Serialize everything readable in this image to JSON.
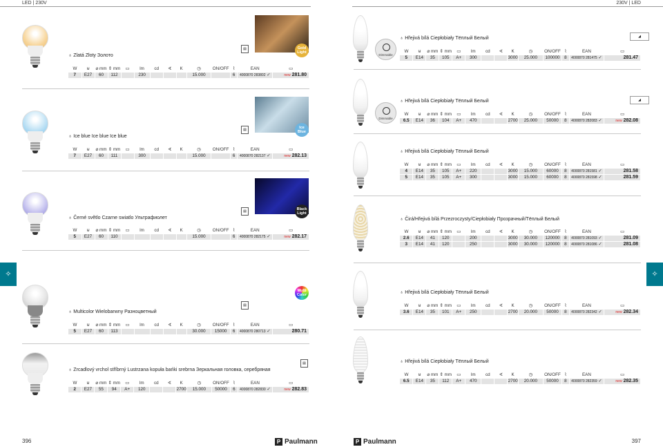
{
  "header": {
    "left": "LED | 230V",
    "right": "230V | LED"
  },
  "headers": {
    "w": "W",
    "socket": "⊌",
    "dia": "⌀ mm",
    "len": "⇕ mm",
    "shape": "▭",
    "lm": "lm",
    "cd": "cd",
    "beam": "∢",
    "k": "K",
    "life": "◷",
    "switch": "ON/OFF",
    "life2": "⌇",
    "ean": "EAN",
    "price": "▭"
  },
  "left_products": [
    {
      "name": "Zlatá  Złoty  Золото",
      "chip": "Gold Light",
      "rows": [
        {
          "w": "7",
          "socket": "E27",
          "dia": "60",
          "len": "112",
          "cls": "",
          "lm": "230",
          "cd": "",
          "beam": "",
          "k": "",
          "life": "15.000",
          "sw": "",
          "pack": "6",
          "ean": "4000870 283802",
          "new": "new",
          "price": "281.80"
        }
      ]
    },
    {
      "name": "Ice blue  Ice blue  Ice blue",
      "chip": "Ice Blue",
      "rows": [
        {
          "w": "7",
          "socket": "E27",
          "dia": "60",
          "len": "111",
          "cls": "",
          "lm": "300",
          "cd": "",
          "beam": "",
          "k": "",
          "life": "15.000",
          "sw": "",
          "pack": "6",
          "ean": "4000870 282137",
          "new": "new",
          "price": "282.13"
        }
      ]
    },
    {
      "name": "Černé světlo  Czarne swiatlo  Ультрафиолет",
      "chip": "Black Light",
      "rows": [
        {
          "w": "5",
          "socket": "E27",
          "dia": "60",
          "len": "110",
          "cls": "",
          "lm": "",
          "cd": "",
          "beam": "",
          "k": "",
          "life": "15.000",
          "sw": "",
          "pack": "6",
          "ean": "4000870 282175",
          "new": "new",
          "price": "282.17"
        }
      ]
    },
    {
      "name": "Multicolor  Wielobarwny  Разноцветный",
      "chip": "Multi Color",
      "rows": [
        {
          "w": "5",
          "socket": "E27",
          "dia": "60",
          "len": "113",
          "cls": "",
          "lm": "",
          "cd": "",
          "beam": "",
          "k": "",
          "life": "30.000",
          "sw": "15000",
          "pack": "6",
          "ean": "4000870 280713",
          "new": "",
          "price": "280.71"
        }
      ]
    },
    {
      "name": "Zrcadlový vrchol stříbrný  Lustrzana kopuła bańki srebrna  Зеркальная головка, серебряная",
      "chip": "",
      "rows": [
        {
          "w": "2",
          "socket": "E27",
          "dia": "55",
          "len": "94",
          "cls": "A+",
          "lm": "120",
          "cd": "",
          "beam": "",
          "k": "2700",
          "life": "15.000",
          "sw": "50000",
          "pack": "6",
          "ean": "4000870 282830",
          "new": "new",
          "price": "282.83"
        }
      ]
    }
  ],
  "right_products": [
    {
      "name": "Hřejivá bílá  Ciepłobiały  Тёплый Белый",
      "dimmable": "Dimmable",
      "rows": [
        {
          "w": "5",
          "socket": "E14",
          "dia": "35",
          "len": "105",
          "cls": "A+",
          "lm": "300",
          "cd": "",
          "beam": "",
          "k": "3000",
          "life": "25.000",
          "sw": "100000",
          "pack": "8",
          "ean": "4000870 281475",
          "new": "",
          "price": "281.47"
        }
      ]
    },
    {
      "name": "Hřejivá bílá  Ciepłobiały  Тёплый Белый",
      "dimmable": "Dimmable",
      "rows": [
        {
          "w": "6.5",
          "socket": "E14",
          "dia": "36",
          "len": "104",
          "cls": "A+",
          "lm": "470",
          "cd": "",
          "beam": "",
          "k": "2700",
          "life": "25.000",
          "sw": "50000",
          "pack": "8",
          "ean": "4000870 282083",
          "new": "new",
          "price": "282.08"
        }
      ]
    },
    {
      "name": "Hřejivá bílá  Ciepłobiały  Тёплый Белый",
      "dimmable": "",
      "rows": [
        {
          "w": "4",
          "socket": "E14",
          "dia": "35",
          "len": "105",
          "cls": "A+",
          "lm": "220",
          "cd": "",
          "beam": "",
          "k": "3000",
          "life": "15.000",
          "sw": "60000",
          "pack": "8",
          "ean": "4000870 281581",
          "new": "",
          "price": "281.58"
        },
        {
          "w": "5",
          "socket": "E14",
          "dia": "35",
          "len": "105",
          "cls": "A+",
          "lm": "300",
          "cd": "",
          "beam": "",
          "k": "3000",
          "life": "15.000",
          "sw": "60000",
          "pack": "8",
          "ean": "4000870 281598",
          "new": "",
          "price": "281.59"
        }
      ]
    },
    {
      "name": "Čirá/Hřejivá bílá  Przezroczysty/Ciepłobiały  Прозрачный/Тёплый Белый",
      "dimmable": "",
      "rows": [
        {
          "w": "2.6",
          "socket": "E14",
          "dia": "41",
          "len": "120",
          "cls": "",
          "lm": "200",
          "cd": "",
          "beam": "",
          "k": "3000",
          "life": "30.000",
          "sw": "120000",
          "pack": "8",
          "ean": "4000870 281093",
          "new": "",
          "price": "281.09"
        },
        {
          "w": "3",
          "socket": "E14",
          "dia": "41",
          "len": "120",
          "cls": "",
          "lm": "250",
          "cd": "",
          "beam": "",
          "k": "3000",
          "life": "30.000",
          "sw": "120000",
          "pack": "8",
          "ean": "4000870 281086",
          "new": "",
          "price": "281.08"
        }
      ]
    },
    {
      "name": "Hřejivá bílá  Ciepłobiały  Тёплый Белый",
      "dimmable": "",
      "rows": [
        {
          "w": "3.6",
          "socket": "E14",
          "dia": "35",
          "len": "101",
          "cls": "A+",
          "lm": "250",
          "cd": "",
          "beam": "",
          "k": "2700",
          "life": "20.000",
          "sw": "50000",
          "pack": "8",
          "ean": "4000870 282342",
          "new": "new",
          "price": "282.34"
        }
      ]
    },
    {
      "name": "Hřejivá bílá  Ciepłobiały  Тёплый Белый",
      "dimmable": "",
      "rows": [
        {
          "w": "6.5",
          "socket": "E14",
          "dia": "35",
          "len": "112",
          "cls": "A+",
          "lm": "470",
          "cd": "",
          "beam": "",
          "k": "2700",
          "life": "20.000",
          "sw": "50000",
          "pack": "8",
          "ean": "4000870 282359",
          "new": "new",
          "price": "282.35"
        }
      ]
    }
  ],
  "footer": {
    "page_left": "396",
    "page_right": "397",
    "brand": "Paulmann",
    "brand_mark": "P"
  },
  "side_tab_icon": "bulb-icon",
  "colors": {
    "accent": "#00798e",
    "new": "#d22222",
    "cell": "#e3e3e3"
  }
}
